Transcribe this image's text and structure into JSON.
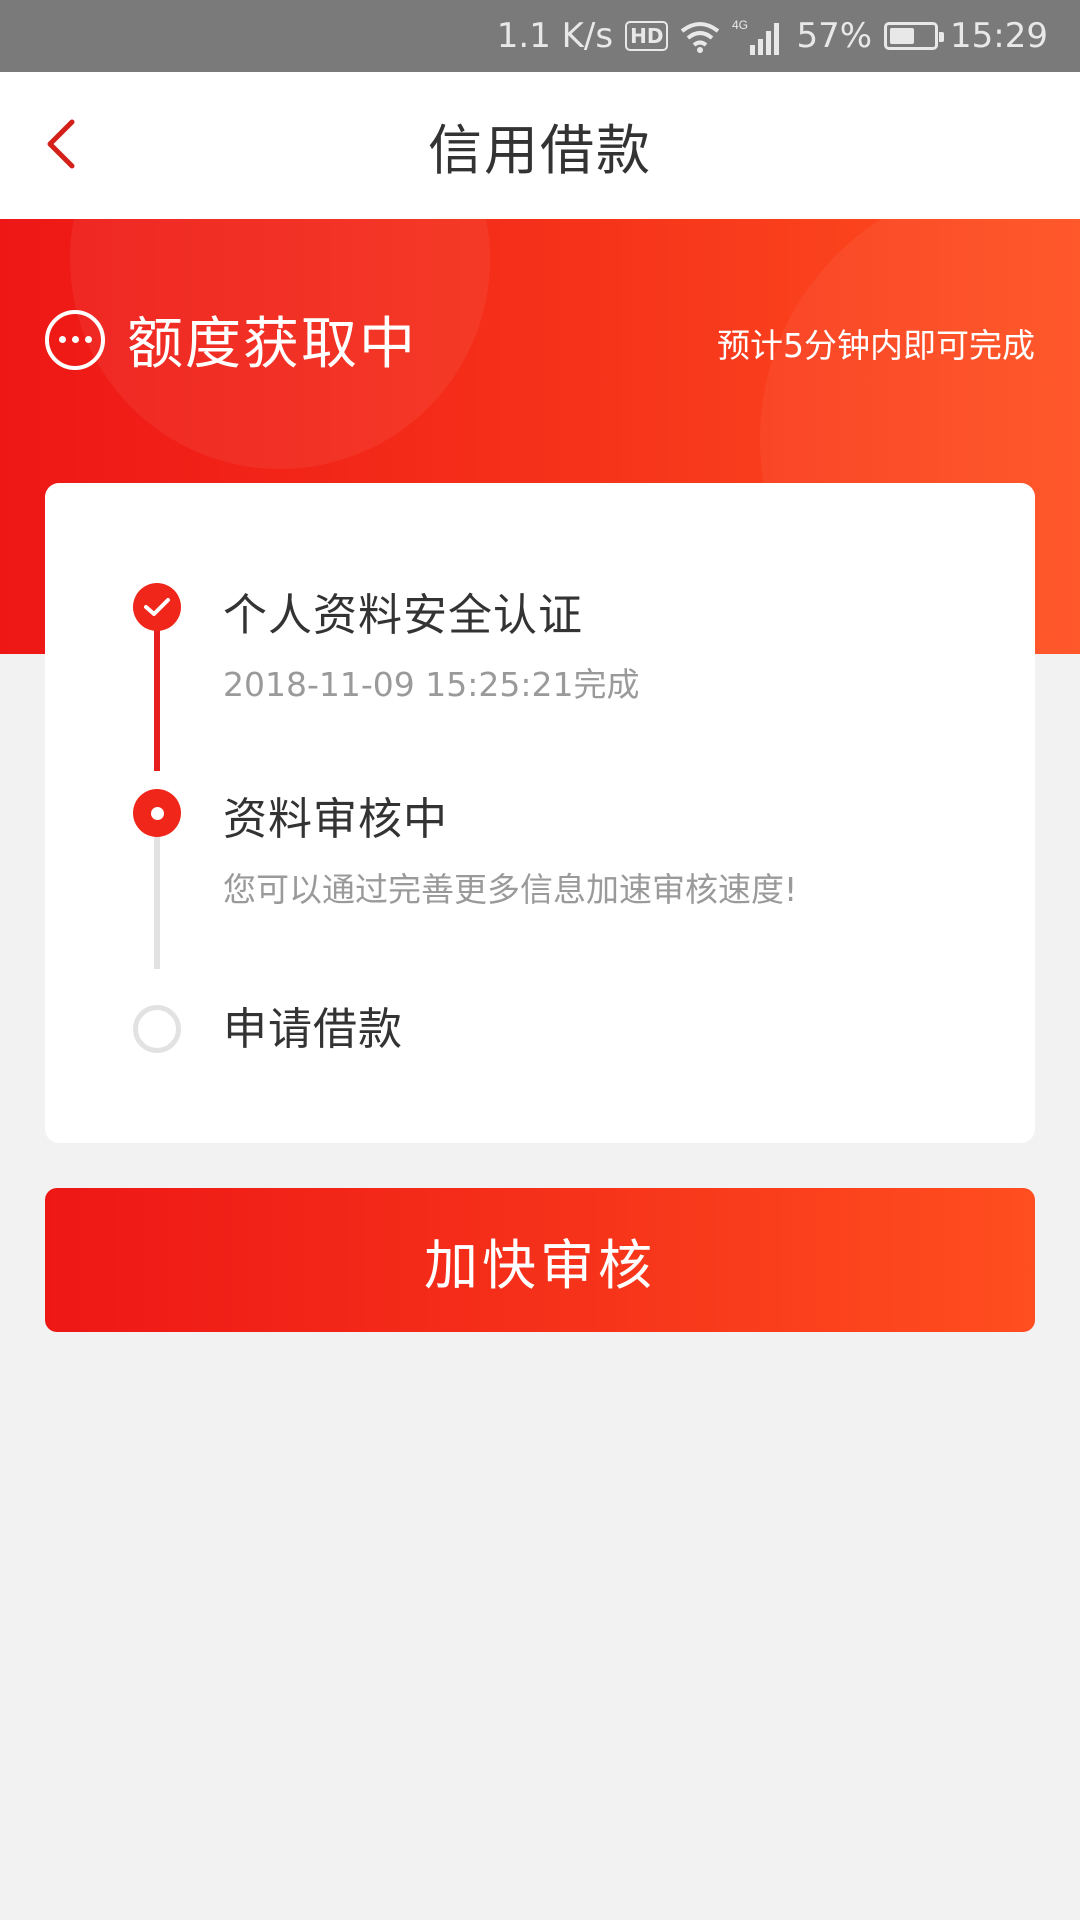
{
  "status_bar": {
    "net_speed": "1.1 K/s",
    "hd_badge": "HD",
    "network_type": "4G",
    "battery": "57%",
    "battery_level": 0.57,
    "time": "15:29"
  },
  "nav": {
    "title": "信用借款",
    "back_icon": "chevron-left-icon"
  },
  "banner": {
    "status_title": "额度获取中",
    "eta": "预计5分钟内即可完成",
    "icon": "more-dots-icon"
  },
  "steps": [
    {
      "title": "个人资料安全认证",
      "subtitle": "2018-11-09 15:25:21完成",
      "state": "done"
    },
    {
      "title": "资料审核中",
      "subtitle": "您可以通过完善更多信息加速审核速度!",
      "state": "active"
    },
    {
      "title": "申请借款",
      "subtitle": "",
      "state": "pending"
    }
  ],
  "action": {
    "button_label": "加快审核"
  },
  "colors": {
    "accent": "#f0261a",
    "gradient_start": "#ee1716",
    "gradient_end": "#ff5020",
    "page_bg": "#f2f2f2"
  }
}
